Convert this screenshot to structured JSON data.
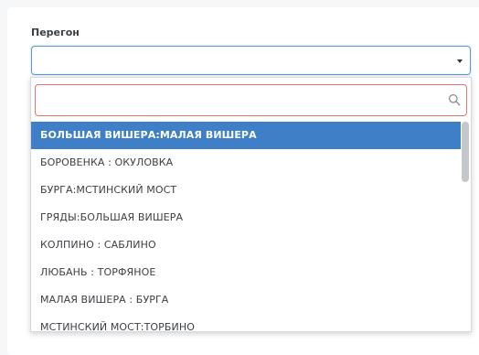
{
  "field": {
    "label": "Перегон",
    "value": ""
  },
  "dropdown": {
    "search_value": "",
    "options": [
      "БОЛЬШАЯ ВИШЕРА:МАЛАЯ ВИШЕРА",
      "БОРОВЕНКА : ОКУЛОВКА",
      "БУРГА:МСТИНСКИЙ МОСТ",
      "ГРЯДЫ:БОЛЬШАЯ ВИШЕРА",
      "КОЛПИНО : САБЛИНО",
      "ЛЮБАНЬ : ТОРФЯНОЕ",
      "МАЛАЯ ВИШЕРА : БУРГА",
      "МСТИНСКИЙ МОСТ:ТОРБИНО"
    ],
    "selected_index": 0
  },
  "colors": {
    "accent": "#3e7fc7",
    "search_border": "#e4746f",
    "select_border": "#5b9bd5"
  },
  "icons": {
    "caret": "caret-down-icon",
    "search": "search-icon"
  }
}
